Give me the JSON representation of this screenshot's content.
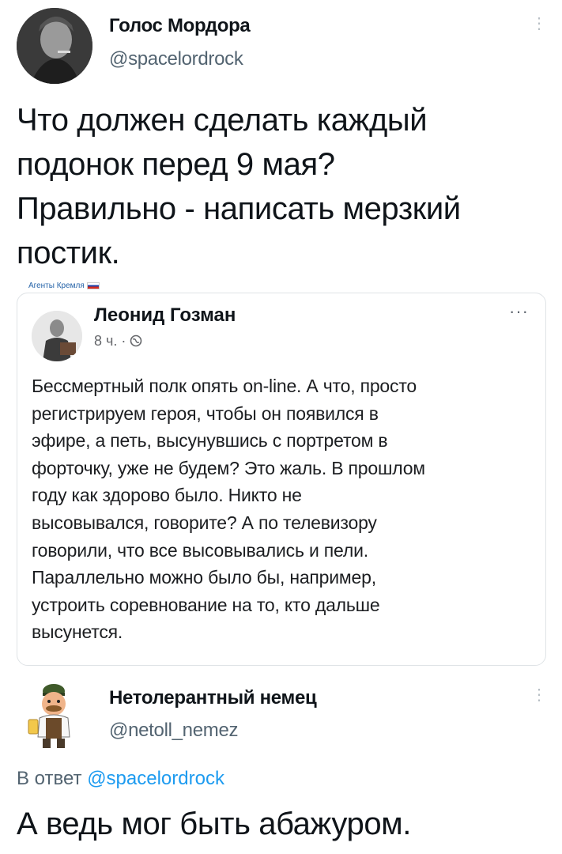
{
  "tweet1": {
    "author_name": "Голос Мордора",
    "handle": "@spacelordrock",
    "text_lines": [
      "Что должен сделать каждый",
      "подонок перед 9 мая?",
      "Правильно - написать мерзкий",
      "постик."
    ]
  },
  "watermark": "Агенты Кремля",
  "fb_post": {
    "author_name": "Леонид Гозман",
    "meta": "8 ч. ·",
    "body_lines": [
      "Бессмертный полк опять on-line. А что, просто",
      "регистрируем героя, чтобы он появился в",
      "эфире, а петь, высунувшись с портретом в",
      "форточку, уже не будем? Это жаль. В прошлом",
      "году как здорово было. Никто не",
      "высовывался, говорите? А по телевизору",
      "говорили, что все высовывались и пели.",
      "Параллельно можно было бы, например,",
      "устроить соревнование на то, кто дальше",
      "высунется."
    ]
  },
  "tweet2": {
    "author_name": "Нетолерантный немец",
    "handle": "@netoll_nemez",
    "reply_prefix": "В ответ",
    "reply_handle": "@spacelordrock",
    "text": "А ведь мог быть абажуром."
  }
}
